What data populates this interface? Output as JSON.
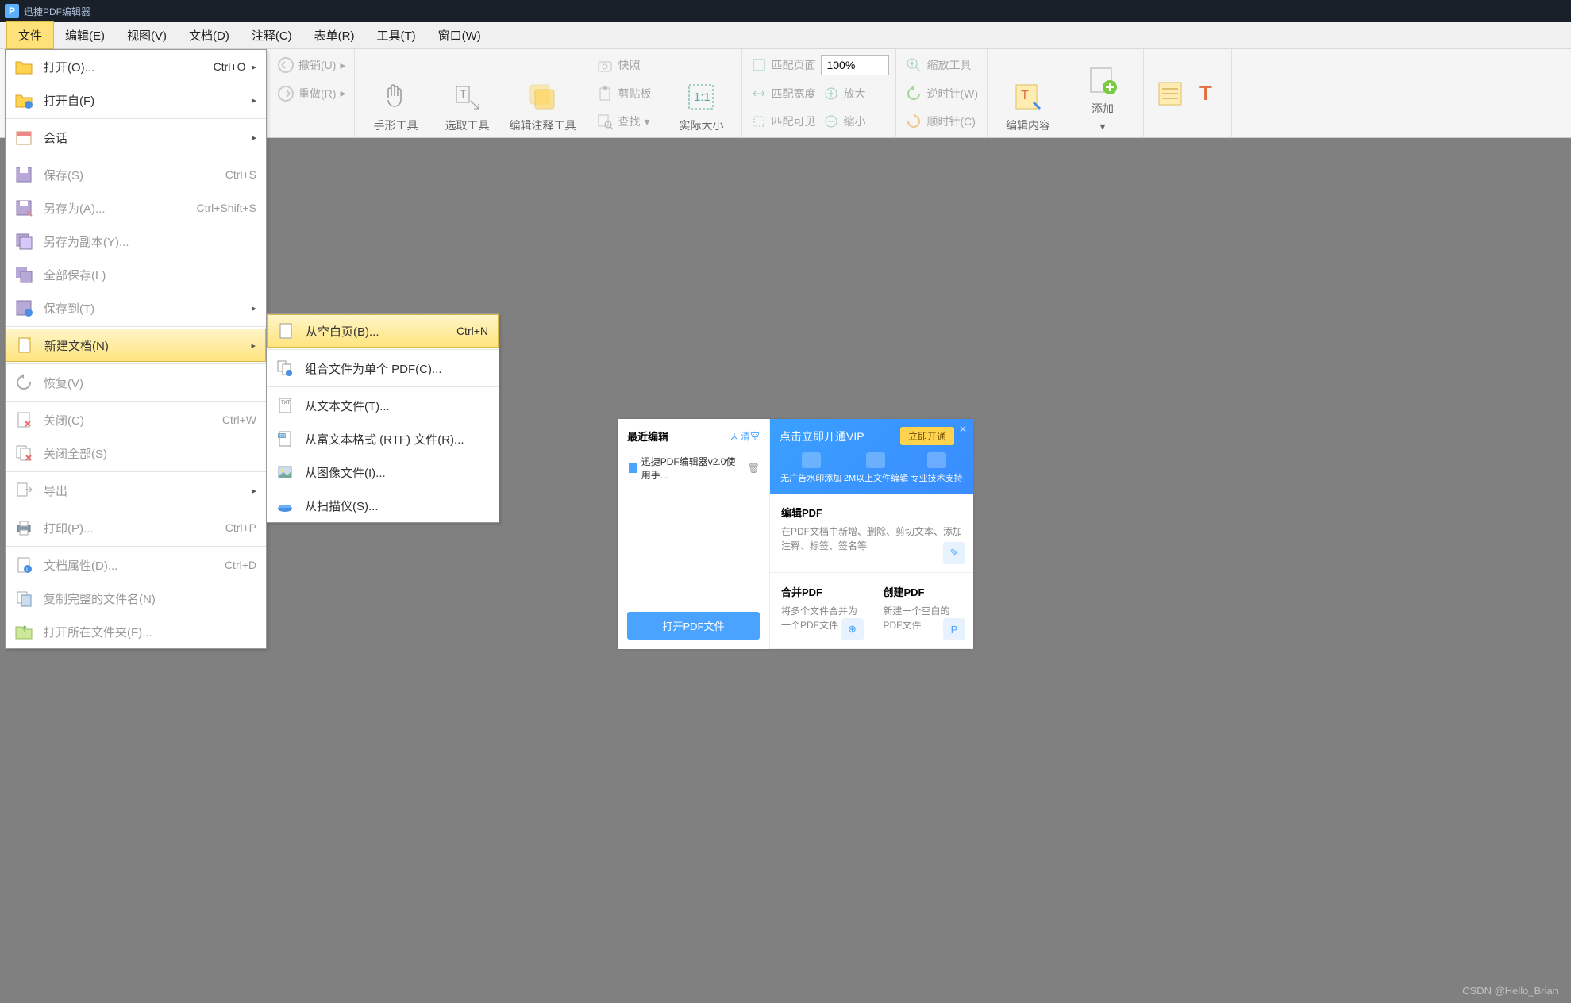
{
  "app": {
    "title": "迅捷PDF编辑器"
  },
  "menubar": {
    "items": [
      "文件",
      "编辑(E)",
      "视图(V)",
      "文档(D)",
      "注释(C)",
      "表单(R)",
      "工具(T)",
      "窗口(W)"
    ]
  },
  "ribbon": {
    "undo": "撤销(U)",
    "redo": "重做(R)",
    "hand": "手形工具",
    "select": "选取工具",
    "annot": "编辑注释工具",
    "snapshot": "快照",
    "clipboard": "剪贴板",
    "find": "查找",
    "actual": "实际大小",
    "fit_page": "匹配页面",
    "fit_width": "匹配宽度",
    "fit_visible": "匹配可见",
    "zoom_val": "100%",
    "zoom_in": "放大",
    "zoom_out": "缩小",
    "zoom_tool": "缩放工具",
    "rotate_ccw": "逆时针(W)",
    "rotate_cw": "顺时针(C)",
    "edit_content": "编辑内容",
    "add": "添加"
  },
  "file_menu": {
    "open": {
      "label": "打开(O)...",
      "shortcut": "Ctrl+O"
    },
    "open_from": {
      "label": "打开自(F)"
    },
    "session": {
      "label": "会话"
    },
    "save": {
      "label": "保存(S)",
      "shortcut": "Ctrl+S"
    },
    "save_as": {
      "label": "另存为(A)...",
      "shortcut": "Ctrl+Shift+S"
    },
    "save_copy": {
      "label": "另存为副本(Y)..."
    },
    "save_all": {
      "label": "全部保存(L)"
    },
    "save_to": {
      "label": "保存到(T)"
    },
    "new_doc": {
      "label": "新建文档(N)"
    },
    "restore": {
      "label": "恢复(V)"
    },
    "close": {
      "label": "关闭(C)",
      "shortcut": "Ctrl+W"
    },
    "close_all": {
      "label": "关闭全部(S)"
    },
    "export": {
      "label": "导出"
    },
    "print": {
      "label": "打印(P)...",
      "shortcut": "Ctrl+P"
    },
    "doc_props": {
      "label": "文档属性(D)...",
      "shortcut": "Ctrl+D"
    },
    "copy_fullname": {
      "label": "复制完整的文件名(N)"
    },
    "open_folder": {
      "label": "打开所在文件夹(F)..."
    }
  },
  "submenu": {
    "blank": {
      "label": "从空白页(B)...",
      "shortcut": "Ctrl+N"
    },
    "combine": {
      "label": "组合文件为单个 PDF(C)..."
    },
    "from_text": {
      "label": "从文本文件(T)..."
    },
    "from_rtf": {
      "label": "从富文本格式 (RTF) 文件(R)..."
    },
    "from_image": {
      "label": "从图像文件(I)..."
    },
    "from_scanner": {
      "label": "从扫描仪(S)..."
    }
  },
  "panel": {
    "recent_title": "最近编辑",
    "clear": "清空",
    "recent_file": "迅捷PDF编辑器v2.0使用手...",
    "open_btn": "打开PDF文件",
    "vip_title": "点击立即开通VIP",
    "vip_btn": "立即开通",
    "feat1": "无广告水印添加",
    "feat2": "2M以上文件编辑",
    "feat3": "专业技术支持",
    "edit_title": "编辑PDF",
    "edit_desc": "在PDF文档中新增、删除、剪切文本、添加注释、标签、签名等",
    "merge_title": "合并PDF",
    "merge_desc": "将多个文件合并为一个PDF文件",
    "create_title": "创建PDF",
    "create_desc": "新建一个空白的PDF文件"
  },
  "watermark": "CSDN @Hello_Brian"
}
